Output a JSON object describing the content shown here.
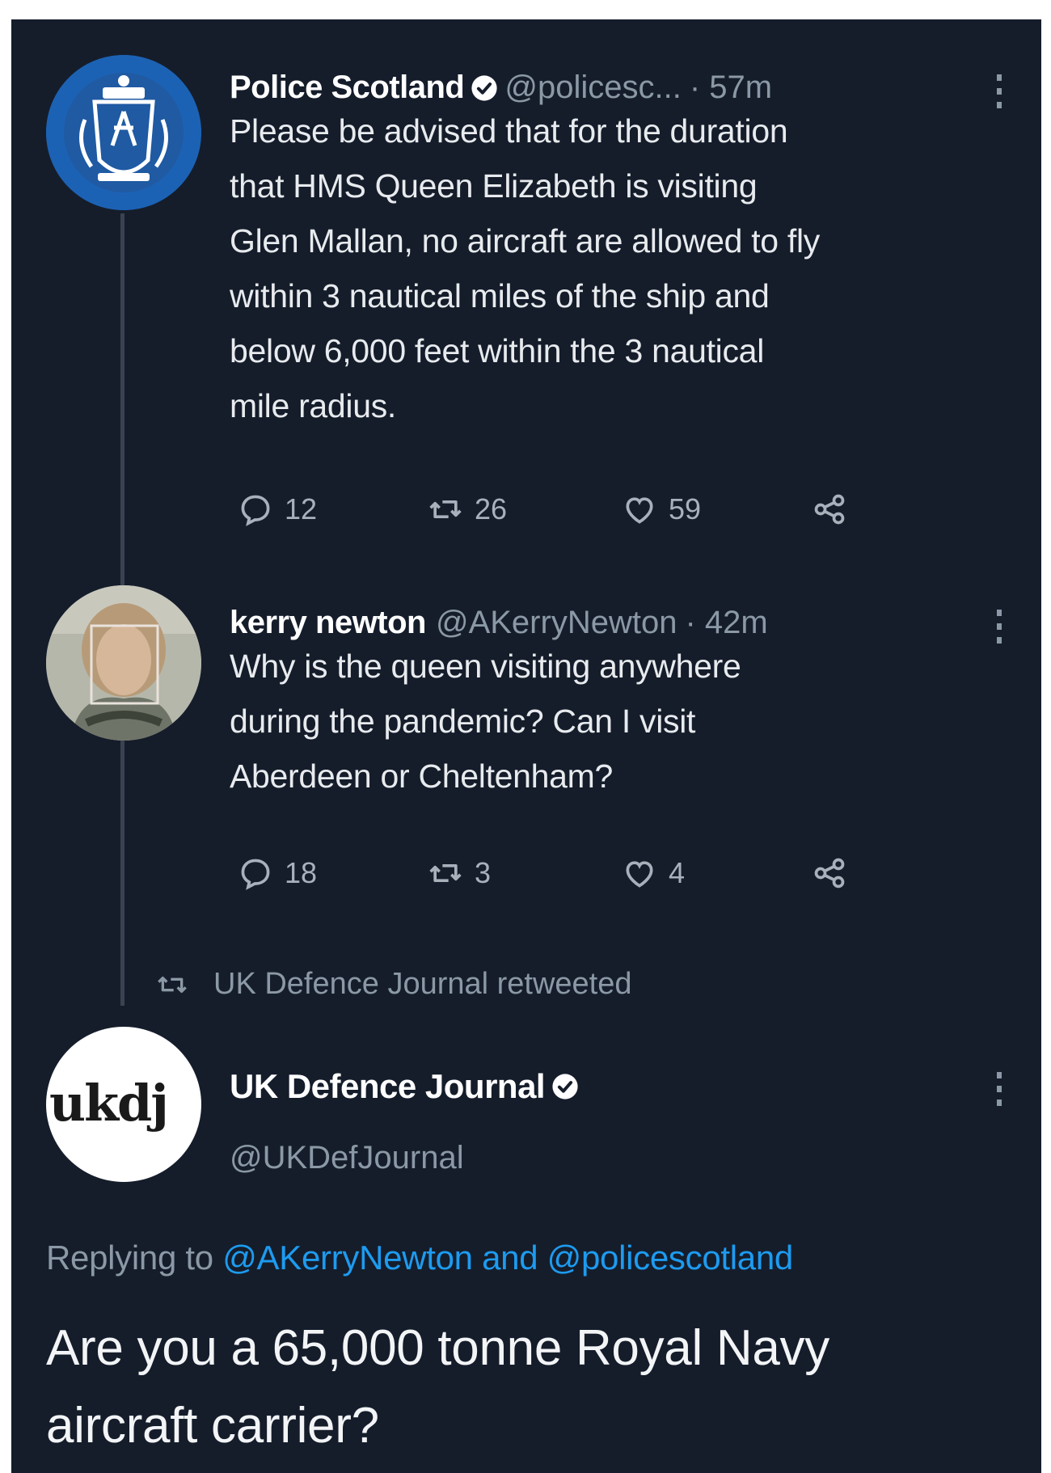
{
  "tweets": [
    {
      "name": "Police Scotland",
      "handle": "@policesc...",
      "time": "· 57m",
      "text_lines": [
        "Please be advised that for the duration",
        "that HMS Queen Elizabeth is visiting",
        "Glen Mallan, no aircraft are allowed to fly",
        "within 3 nautical miles of the ship and",
        "below 6,000 feet within the 3 nautical",
        "mile radius."
      ],
      "replies": "12",
      "retweets": "26",
      "likes": "59"
    },
    {
      "name": "kerry newton",
      "handle": "@AKerryNewton",
      "time": "· 42m",
      "text_lines": [
        "Why is the queen visiting anywhere",
        "during the pandemic?  Can I visit",
        "Aberdeen or Cheltenham?"
      ],
      "replies": "18",
      "retweets": "3",
      "likes": "4"
    }
  ],
  "retweet_notice": "UK Defence Journal retweeted",
  "main_tweet": {
    "name": "UK Defence Journal",
    "handle": "@UKDefJournal",
    "avatar_text": "ukdj",
    "replying_prefix": "Replying to",
    "replying_user1": "@AKerryNewton",
    "replying_and": "and",
    "replying_user2": "@policescotland",
    "text_lines": [
      "Are you a 65,000 tonne Royal Navy",
      "aircraft carrier?"
    ]
  },
  "colors": {
    "background": "#151d2b",
    "link": "#1d9bf0",
    "muted": "#8b98a5"
  },
  "icons": [
    "verified-badge-icon",
    "reply-icon",
    "retweet-icon",
    "like-icon",
    "share-icon",
    "more-options-icon"
  ]
}
